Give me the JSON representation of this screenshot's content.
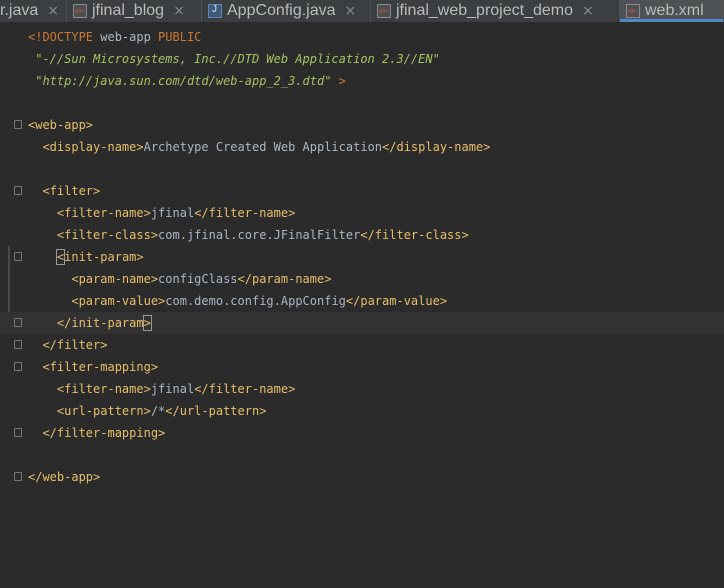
{
  "tabs": [
    {
      "label": "r.java",
      "icon": "java-file-icon",
      "active": false
    },
    {
      "label": "jfinal_blog",
      "icon": "xml-file-icon",
      "active": false
    },
    {
      "label": "AppConfig.java",
      "icon": "java-file-icon",
      "active": false
    },
    {
      "label": "jfinal_web_project_demo",
      "icon": "xml-file-icon",
      "active": false
    },
    {
      "label": "web.xml",
      "icon": "xml-file-icon",
      "active": true
    }
  ],
  "tab_close_glyph": "×",
  "caret_line": 13,
  "lines": [
    {
      "fold": false,
      "segs": [
        {
          "t": "<!DOCTYPE ",
          "c": "dtd"
        },
        {
          "t": "web-app ",
          "c": "txt"
        },
        {
          "t": "PUBLIC",
          "c": "dtd"
        }
      ]
    },
    {
      "fold": false,
      "segs": [
        {
          "t": " \"-//Sun Microsystems, Inc.//DTD Web Application 2.3//EN\"",
          "c": "str"
        }
      ]
    },
    {
      "fold": false,
      "segs": [
        {
          "t": " \"http://java.sun.com/dtd/web-app_2_3.dtd\"",
          "c": "str"
        },
        {
          "t": " >",
          "c": "dtd"
        }
      ]
    },
    {
      "fold": false,
      "segs": []
    },
    {
      "fold": true,
      "segs": [
        {
          "t": "<web-app>",
          "c": "tag"
        }
      ]
    },
    {
      "fold": false,
      "segs": [
        {
          "t": "  <display-name>",
          "c": "tag"
        },
        {
          "t": "Archetype Created Web Application",
          "c": "txt"
        },
        {
          "t": "</display-name>",
          "c": "tag"
        }
      ]
    },
    {
      "fold": false,
      "segs": []
    },
    {
      "fold": true,
      "segs": [
        {
          "t": "  <filter>",
          "c": "tag"
        }
      ]
    },
    {
      "fold": false,
      "segs": [
        {
          "t": "    <filter-name>",
          "c": "tag"
        },
        {
          "t": "jfinal",
          "c": "txt"
        },
        {
          "t": "</filter-name>",
          "c": "tag"
        }
      ]
    },
    {
      "fold": false,
      "segs": [
        {
          "t": "    <filter-class>",
          "c": "tag"
        },
        {
          "t": "com.jfinal.core.JFinalFilter",
          "c": "txt"
        },
        {
          "t": "</filter-class>",
          "c": "tag"
        }
      ]
    },
    {
      "fold": true,
      "segs": [
        {
          "t": "    ",
          "c": "tag"
        },
        {
          "t": "<",
          "c": "tag brk"
        },
        {
          "t": "init-param>",
          "c": "tag"
        }
      ]
    },
    {
      "fold": false,
      "segs": [
        {
          "t": "      <param-name>",
          "c": "tag"
        },
        {
          "t": "configClass",
          "c": "txt"
        },
        {
          "t": "</param-name>",
          "c": "tag"
        }
      ]
    },
    {
      "fold": false,
      "segs": [
        {
          "t": "      <param-value>",
          "c": "tag"
        },
        {
          "t": "com.demo.config.AppConfig",
          "c": "txt"
        },
        {
          "t": "</param-value>",
          "c": "tag"
        }
      ]
    },
    {
      "fold": true,
      "segs": [
        {
          "t": "    </init-param",
          "c": "tag"
        },
        {
          "t": ">",
          "c": "tag brk"
        }
      ]
    },
    {
      "fold": true,
      "segs": [
        {
          "t": "  </filter>",
          "c": "tag"
        }
      ]
    },
    {
      "fold": true,
      "segs": [
        {
          "t": "  <filter-mapping>",
          "c": "tag"
        }
      ]
    },
    {
      "fold": false,
      "segs": [
        {
          "t": "    <filter-name>",
          "c": "tag"
        },
        {
          "t": "jfinal",
          "c": "txt"
        },
        {
          "t": "</filter-name>",
          "c": "tag"
        }
      ]
    },
    {
      "fold": false,
      "segs": [
        {
          "t": "    <url-pattern>",
          "c": "tag"
        },
        {
          "t": "/*",
          "c": "txt"
        },
        {
          "t": "</url-pattern>",
          "c": "tag"
        }
      ]
    },
    {
      "fold": true,
      "segs": [
        {
          "t": "  </filter-mapping>",
          "c": "tag"
        }
      ]
    },
    {
      "fold": false,
      "segs": []
    },
    {
      "fold": true,
      "segs": [
        {
          "t": "</web-app>",
          "c": "tag"
        }
      ]
    }
  ]
}
